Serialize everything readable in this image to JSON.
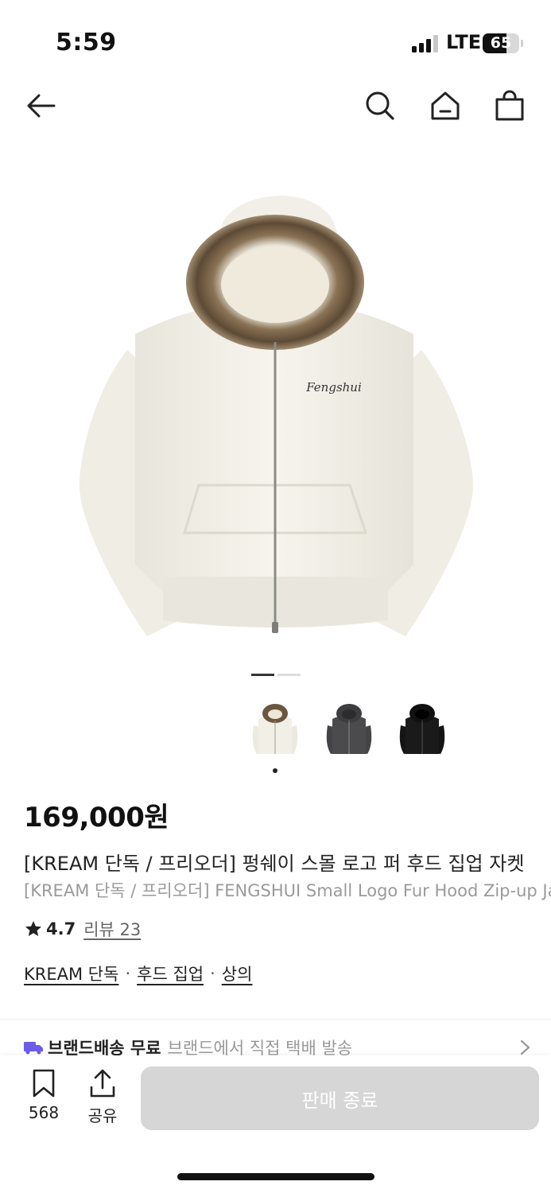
{
  "status_bar": {
    "time": "5:59",
    "network": "LTE",
    "battery_percent": "65",
    "battery_level": 0.65
  },
  "nav": {
    "back_icon": "arrow-left-icon",
    "search_icon": "search-icon",
    "home_icon": "home-icon",
    "cart_icon": "shopping-bag-icon"
  },
  "gallery": {
    "current_slide": 1,
    "total_slides": 2
  },
  "thumbnails": [
    {
      "color": "#f1efe6",
      "fur": true,
      "selected": true
    },
    {
      "color": "#4a4a4c",
      "fur": false,
      "selected": false
    },
    {
      "color": "#161616",
      "fur": false,
      "selected": false
    }
  ],
  "product": {
    "price": "169,000원",
    "title_ko": "[KREAM 단독 / 프리오더] 펑쉐이 스몰 로고 퍼 후드 집업 자켓",
    "title_en": "[KREAM 단독 / 프리오더] FENGSHUI Small Logo Fur Hood Zip-up Jacket",
    "chest_logo": "Fengshui",
    "rating": "4.7",
    "review_label": "리뷰 23",
    "tags": [
      "KREAM 단독",
      "후드 집업",
      "상의"
    ],
    "tag_separator": "·"
  },
  "shipping": {
    "title": "브랜드배송 무료",
    "description": "브랜드에서 직접 택배 발송",
    "icon_color": "#6c5ce7"
  },
  "bottom_bar": {
    "wishlist_count": "568",
    "share_label": "공유",
    "cta_label": "판매 종료"
  }
}
